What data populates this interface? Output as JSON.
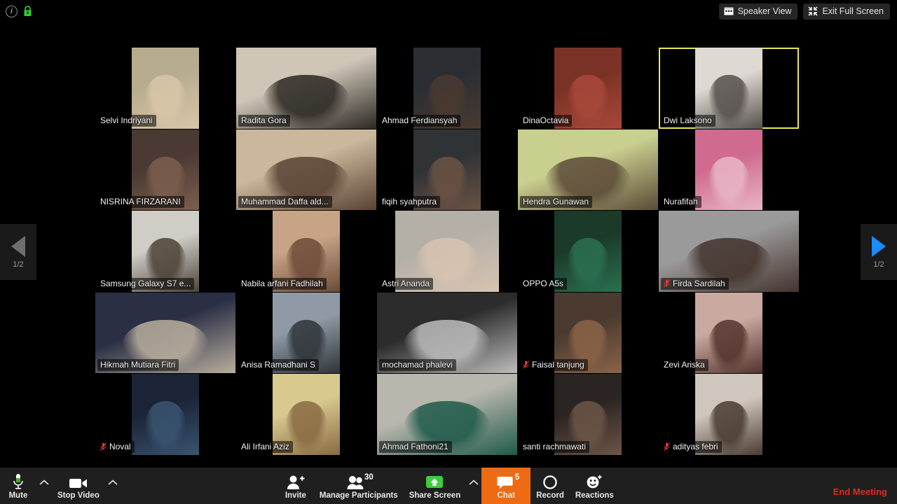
{
  "topbar": {
    "info_icon": "info-icon",
    "lock_icon": "encryption-lock-icon",
    "speaker_view_label": "Speaker View",
    "exit_full_screen_label": "Exit Full Screen"
  },
  "pagination": {
    "prev_label": "1/2",
    "next_label": "1/2"
  },
  "participants": [
    {
      "name": "Selvi Indriyani",
      "muted": false,
      "active": false,
      "crop": "portrait",
      "bg": "#b8ac8e",
      "tone": "#d9c6a8"
    },
    {
      "name": "Radita Gora",
      "muted": false,
      "active": false,
      "crop": "wide",
      "bg": "#cfc6b8",
      "tone": "#2c2823"
    },
    {
      "name": "Ahmad Ferdiansyah",
      "muted": false,
      "active": false,
      "crop": "portrait",
      "bg": "#2a2e33",
      "tone": "#4a3a30"
    },
    {
      "name": "DinaOctavia",
      "muted": false,
      "active": false,
      "crop": "portrait",
      "bg": "#7a3226",
      "tone": "#a8483a"
    },
    {
      "name": "Dwi Laksono",
      "muted": false,
      "active": true,
      "crop": "portrait",
      "bg": "#ded9d2",
      "tone": "#55504c"
    },
    {
      "name": "NISRINA FIRZARANI",
      "muted": false,
      "active": false,
      "crop": "portrait",
      "bg": "#4a3a33",
      "tone": "#7b5f4e"
    },
    {
      "name": "Muhammad Daffa ald...",
      "muted": false,
      "active": false,
      "crop": "wide",
      "bg": "#cbb79c",
      "tone": "#5a4234"
    },
    {
      "name": "fiqih syahputra",
      "muted": false,
      "active": false,
      "crop": "portrait",
      "bg": "#2f3336",
      "tone": "#6b5244"
    },
    {
      "name": "Hendra Gunawan",
      "muted": false,
      "active": false,
      "crop": "wide",
      "bg": "#c9cf8f",
      "tone": "#5c4b38"
    },
    {
      "name": "Nurafifah",
      "muted": false,
      "active": false,
      "crop": "portrait",
      "bg": "#d06a8e",
      "tone": "#e8b6c6"
    },
    {
      "name": "Samsung Galaxy S7 e...",
      "muted": false,
      "active": false,
      "crop": "portrait",
      "bg": "#cfcdc6",
      "tone": "#4d4338"
    },
    {
      "name": "Nabila arfani Fadhilah",
      "muted": false,
      "active": false,
      "crop": "portrait",
      "bg": "#c8a487",
      "tone": "#6d4b38"
    },
    {
      "name": "Astri Ananda",
      "muted": false,
      "active": false,
      "crop": "mid",
      "bg": "#b4b0a8",
      "tone": "#d8c3b0"
    },
    {
      "name": "OPPO A5s",
      "muted": false,
      "active": false,
      "crop": "portrait",
      "bg": "#1b3a2a",
      "tone": "#2b7050"
    },
    {
      "name": "Firda Sardilah",
      "muted": true,
      "active": false,
      "crop": "wide",
      "bg": "#9a9a9a",
      "tone": "#43332c"
    },
    {
      "name": "Hikmah Mutiara Fitri",
      "muted": false,
      "active": false,
      "crop": "wide",
      "bg": "#2a2f44",
      "tone": "#b9ae9e"
    },
    {
      "name": "Anisa Ramadhani S",
      "muted": false,
      "active": false,
      "crop": "portrait",
      "bg": "#8f9aa6",
      "tone": "#2f3438"
    },
    {
      "name": "mochamad phalevi",
      "muted": false,
      "active": false,
      "crop": "wide",
      "bg": "#2c2c2c",
      "tone": "#bdbdbd"
    },
    {
      "name": "Faisal tanjung",
      "muted": true,
      "active": false,
      "crop": "portrait",
      "bg": "#4a3a2f",
      "tone": "#8a6348"
    },
    {
      "name": "Zevi Ariska",
      "muted": false,
      "active": false,
      "crop": "portrait",
      "bg": "#caa9a0",
      "tone": "#55332e"
    },
    {
      "name": "Noval",
      "muted": true,
      "active": false,
      "crop": "portrait",
      "bg": "#1a2436",
      "tone": "#3a5470"
    },
    {
      "name": "Ali Irfani Aziz",
      "muted": false,
      "active": false,
      "crop": "portrait",
      "bg": "#d8c98f",
      "tone": "#8a6a42"
    },
    {
      "name": "Ahmad Fathoni21",
      "muted": false,
      "active": false,
      "crop": "wide",
      "bg": "#b9b6ae",
      "tone": "#1f5a4a"
    },
    {
      "name": "santi rachmawati",
      "muted": false,
      "active": false,
      "crop": "portrait",
      "bg": "#2a2422",
      "tone": "#6d5548"
    },
    {
      "name": "adityas febri",
      "muted": true,
      "active": false,
      "crop": "portrait",
      "bg": "#cfc7bd",
      "tone": "#4a3b32"
    }
  ],
  "toolbar": {
    "mute_label": "Mute",
    "stop_video_label": "Stop Video",
    "invite_label": "Invite",
    "manage_participants_label": "Manage Participants",
    "participants_count": "30",
    "share_screen_label": "Share Screen",
    "chat_label": "Chat",
    "chat_badge": "5",
    "record_label": "Record",
    "reactions_label": "Reactions",
    "end_meeting_label": "End Meeting"
  },
  "colors": {
    "accent_orange": "#ee6b14",
    "end_meeting_red": "#e02b20",
    "active_speaker_border": "#e8e85a",
    "share_green": "#3fcc3f",
    "next_arrow_blue": "#1a8cff"
  }
}
